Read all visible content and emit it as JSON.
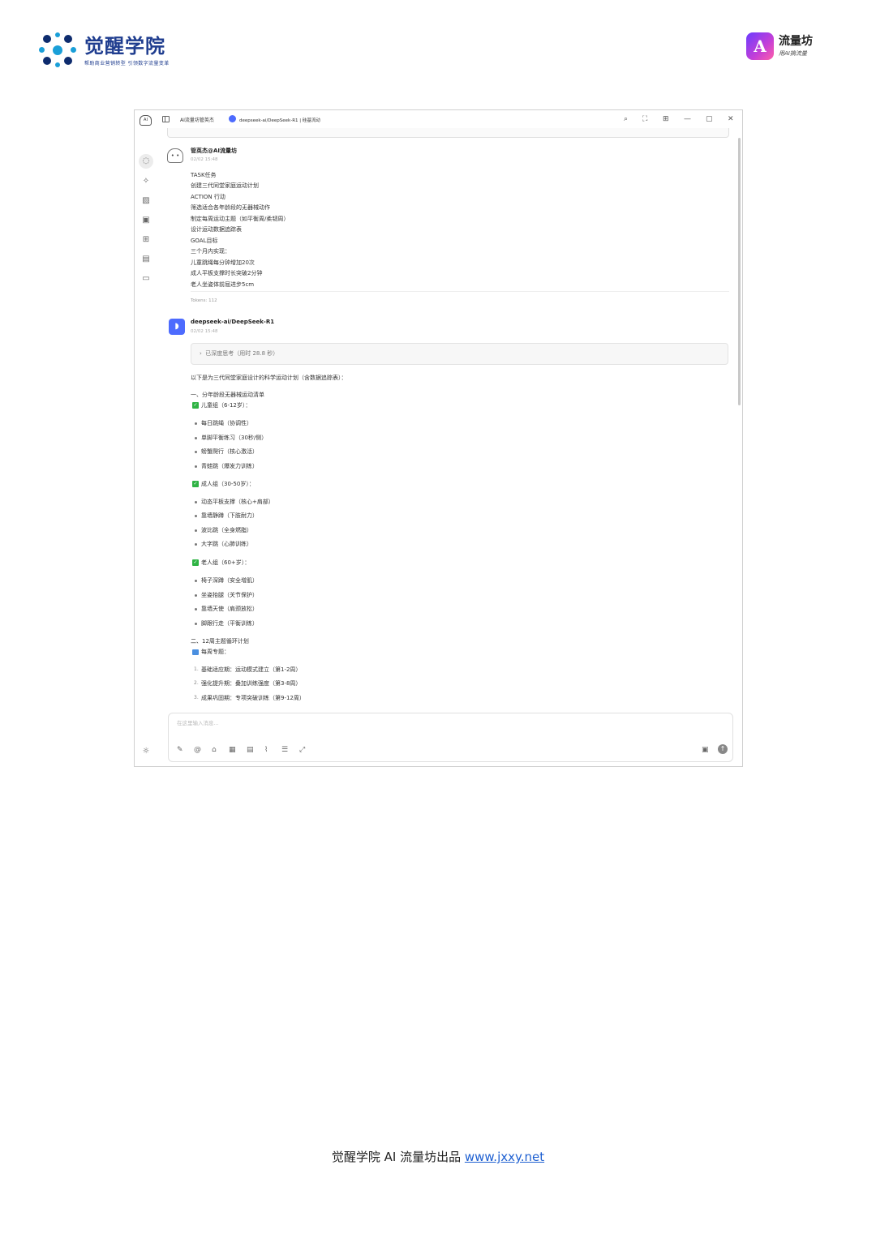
{
  "header": {
    "brand_title": "觉醒学院",
    "brand_subtitle": "帮助商业营销转型 引领数字流量变革",
    "right_logo_title": "流量坊",
    "right_logo_subtitle": "用AI搞流量",
    "right_logo_glyph": "A"
  },
  "window": {
    "app_icon_text": "AI",
    "tab_title": "AI流量坊管英杰",
    "model_title": "deepseek-ai/DeepSeek-R1 | 硅基流动",
    "controls": {
      "search": "⌕",
      "fit": "⛶",
      "grid": "⊞",
      "minimize": "—",
      "maximize": "▢",
      "close": "✕"
    }
  },
  "sidebar": {
    "icons": [
      "chat-icon",
      "sparkle-icon",
      "image-icon",
      "image-add-icon",
      "apps-icon",
      "document-search-icon",
      "folder-icon"
    ],
    "bottom": [
      "sun-icon",
      "settings-icon"
    ]
  },
  "user_message": {
    "name": "管英杰@AI流量坊",
    "time": "02/02 15:48",
    "lines": [
      "TASK任务",
      "创建三代同堂家庭运动计划",
      "ACTION 行动",
      "筛选适合各年龄段的无器械动作",
      "制定每周运动主题（如平衡周/柔韧周）",
      "设计运动数据追踪表",
      "GOAL目标",
      "三个月内实现：",
      "儿童跳绳每分钟增加20次",
      "成人平板支撑时长突破2分钟",
      "老人坐姿体前屈进步5cm"
    ],
    "tokens": "Tokens: 112"
  },
  "assistant_message": {
    "name": "deepseek-ai/DeepSeek-R1",
    "time": "02/02 15:48",
    "thinking": "已深度思考（用时 28.8 秒）",
    "intro": "以下是为三代同堂家庭设计的科学运动计划（含数据追踪表）：",
    "section1": "一、分年龄段无器械运动清单",
    "groups": [
      {
        "label": "儿童组（6-12岁）：",
        "items": [
          "每日跳绳（协调性）",
          "单脚平衡练习（30秒/侧）",
          "螃蟹爬行（核心激活）",
          "青蛙跳（爆发力训练）"
        ]
      },
      {
        "label": "成人组（30-50岁）：",
        "items": [
          "动态平板支撑（核心+肩部）",
          "靠墙静蹲（下肢耐力）",
          "波比跳（全身燃脂）",
          "大字跳（心肺训练）"
        ]
      },
      {
        "label": "老人组（60+岁）：",
        "items": [
          "椅子深蹲（安全增肌）",
          "坐姿抬腿（关节保护）",
          "靠墙天使（肩颈放松）",
          "脚跟行走（平衡训练）"
        ]
      }
    ],
    "section2": "二、12周主题循环计划",
    "weekly_label": "每周专题：",
    "phases": [
      {
        "n": "1.",
        "text": "基础适应期：运动模式建立（第1-2周）"
      },
      {
        "n": "2.",
        "text": "强化提升期：叠加训练强度（第3-8周）"
      },
      {
        "n": "3.",
        "text": "成果巩固期：专项突破训练（第9-12周）"
      }
    ]
  },
  "input": {
    "placeholder": "在这里输入消息..."
  },
  "footer": {
    "text": "觉醒学院  AI 流量坊出品 ",
    "link": "www.jxxy.net"
  }
}
